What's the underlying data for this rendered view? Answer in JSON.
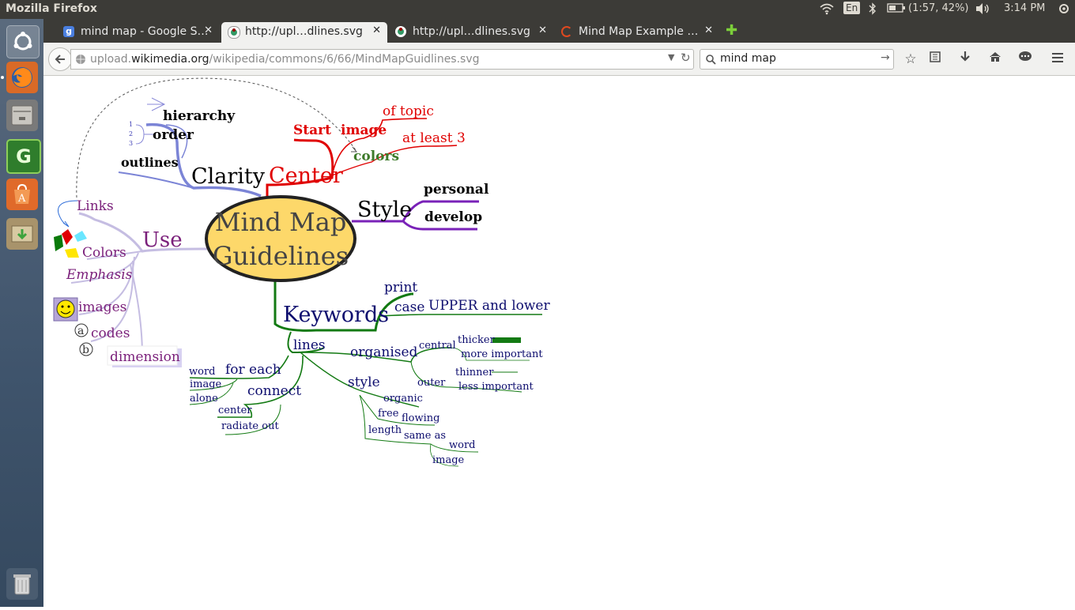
{
  "os": {
    "app_title": "Mozilla Firefox",
    "keyboard_layout": "En",
    "battery": "(1:57, 42%)",
    "clock": "3:14 PM",
    "launcher_apps": [
      "ubuntu-dash",
      "firefox",
      "files",
      "gedit",
      "software-center",
      "archive-manager"
    ]
  },
  "browser": {
    "tabs": [
      {
        "label": "mind map - Google S…",
        "active": false
      },
      {
        "label": "http://upl…dlines.svg",
        "active": true
      },
      {
        "label": "http://upl…dlines.svg",
        "active": false
      },
      {
        "label": "Mind Map Example …",
        "active": false
      }
    ],
    "close_glyph": "✕",
    "new_tab_glyph": "✚",
    "url_prefix": "upload.",
    "url_domain": "wikimedia.org",
    "url_path": "/wikipedia/commons/6/66/MindMapGuidlines.svg",
    "search_value": "mind map"
  },
  "mindmap": {
    "center": [
      "Mind Map",
      "Guidelines"
    ],
    "clarity": {
      "title": "Clarity",
      "hierarchy": "hierarchy",
      "order": "order",
      "outlines": "outlines",
      "order_numbers": [
        "1",
        "2",
        "3"
      ]
    },
    "centerbranch": {
      "title": "Center",
      "start": "Start",
      "image": "image",
      "of_topic": "of topic",
      "colors": "colors",
      "at_least": "at least 3"
    },
    "style": {
      "title": "Style",
      "personal": "personal",
      "develop": "develop"
    },
    "use": {
      "title": "Use",
      "links": "Links",
      "colors": "Colors",
      "emphasis": "Emphasis",
      "images": "images",
      "codes": "codes",
      "dimension": "dimension",
      "code_a": "a",
      "code_b": "b"
    },
    "keywords": {
      "title": "Keywords",
      "print": "print",
      "case": "case",
      "upper_lower": "UPPER and lower",
      "lines": "lines",
      "organised": "organised",
      "central": "central",
      "thicker": "thicker",
      "more_important": "more important",
      "outer": "outer",
      "thinner": "thinner",
      "less_important": "less important",
      "style": "style",
      "organic": "organic",
      "free": "free",
      "flowing": "flowing",
      "length": "length",
      "same_as": "same as",
      "word": "word",
      "image": "image",
      "for_each": "for each",
      "fe_word": "word",
      "fe_image": "image",
      "fe_alone": "alone",
      "connect": "connect",
      "c_center": "center",
      "c_radiate": "radiate out"
    }
  }
}
